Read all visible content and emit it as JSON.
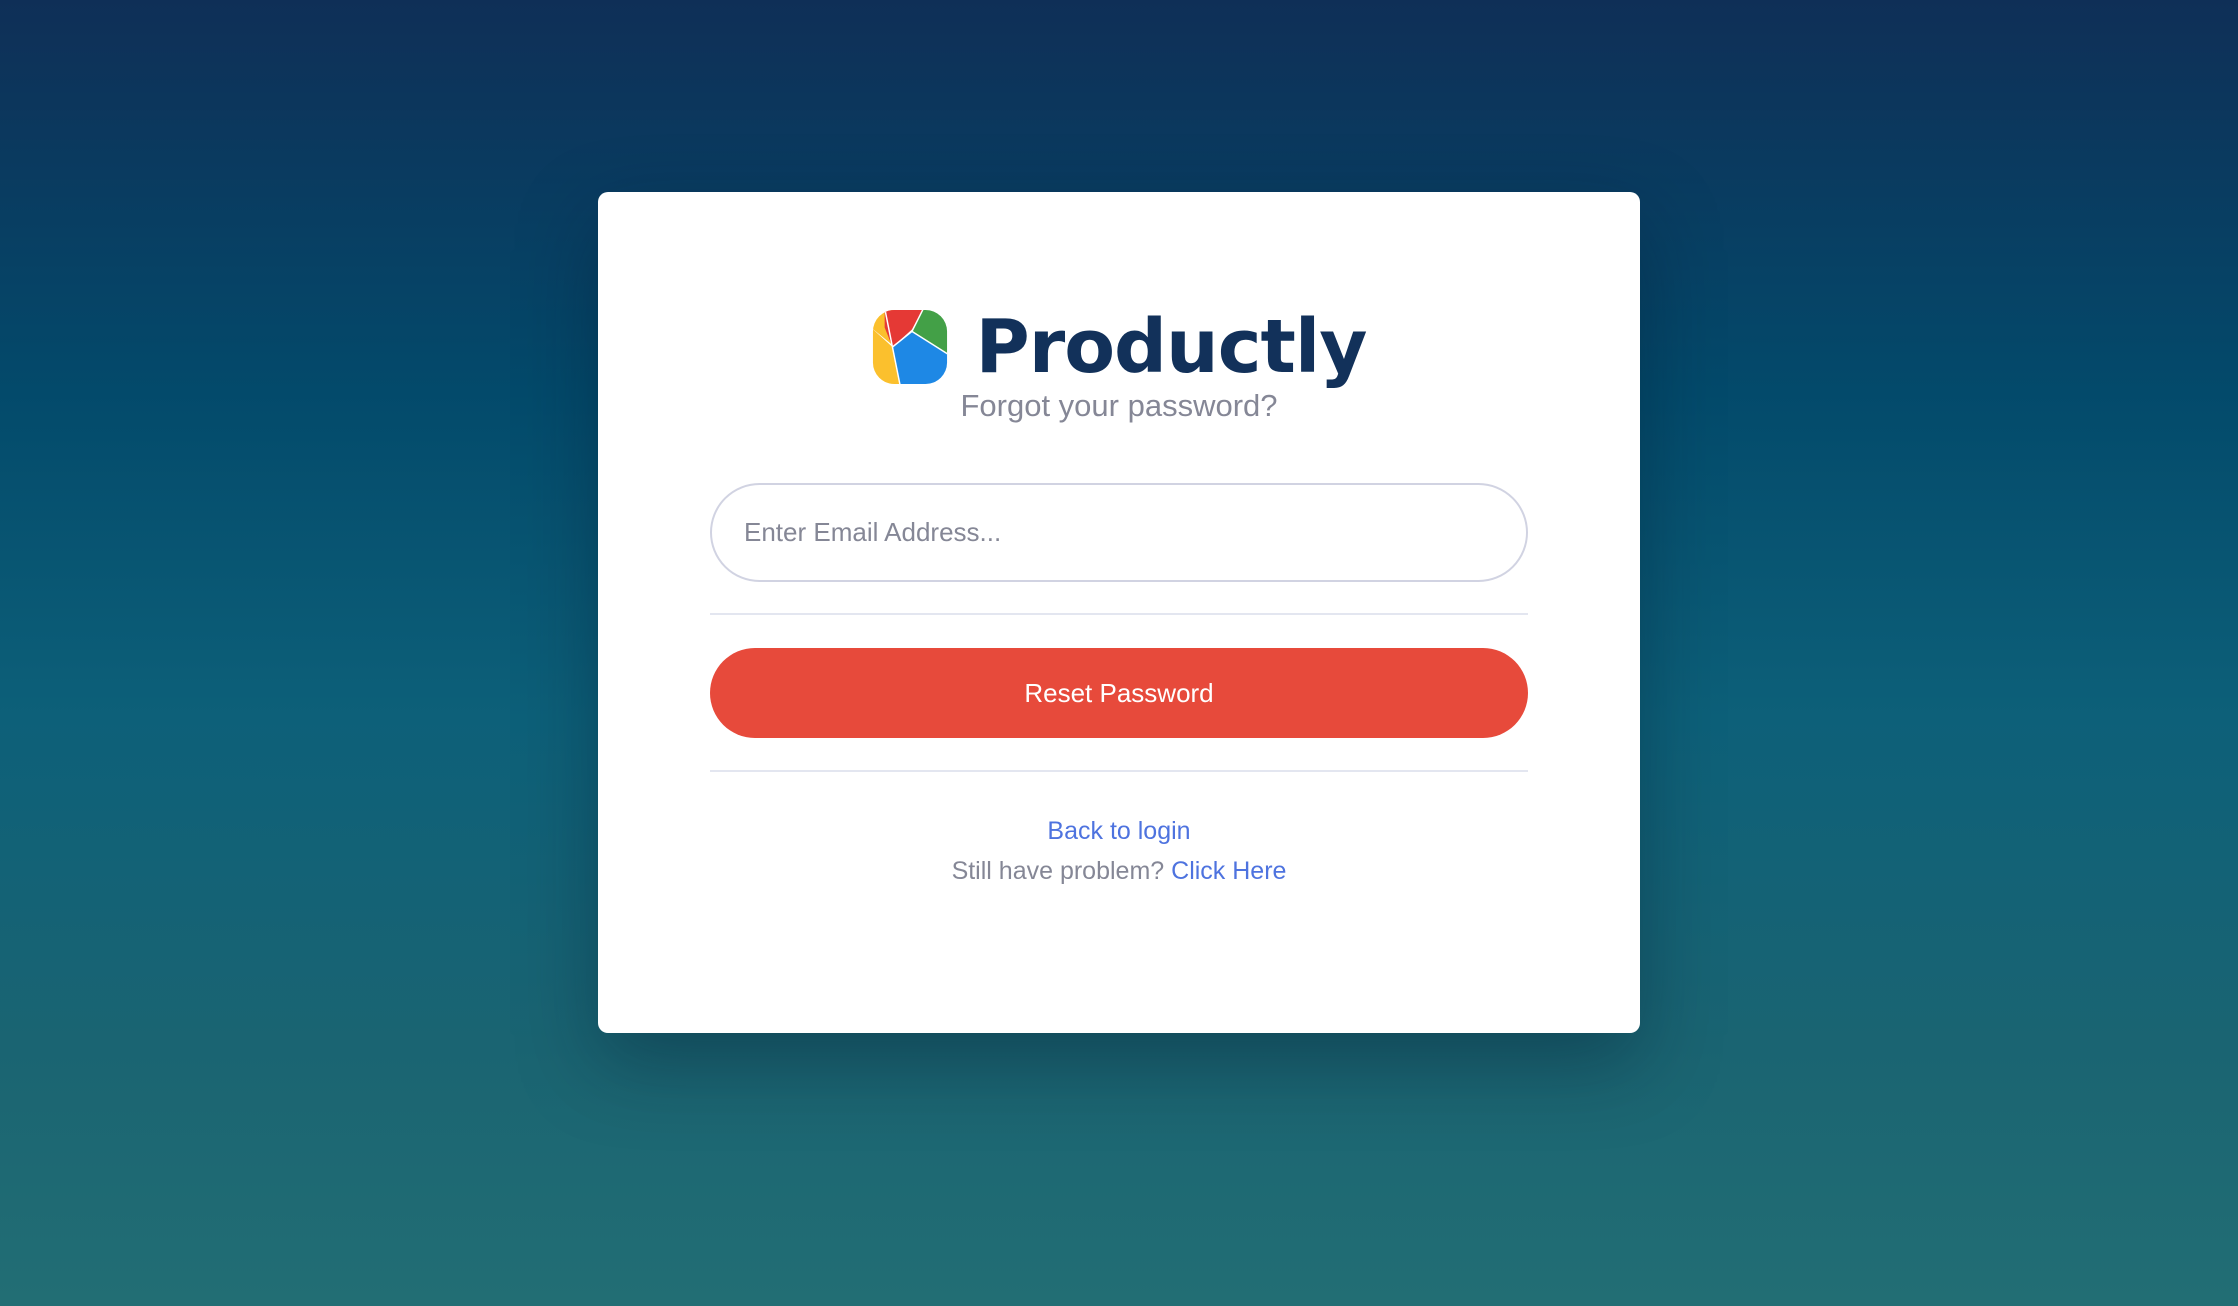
{
  "brand": {
    "name": "Productly",
    "logo_icon": "productly-logo-icon",
    "logo_colors": [
      "#e53935",
      "#43a047",
      "#1e88e5",
      "#fbc02d"
    ]
  },
  "form": {
    "subtitle": "Forgot your password?",
    "email_placeholder": "Enter Email Address...",
    "email_value": "",
    "submit_label": "Reset Password"
  },
  "links": {
    "back_to_login": "Back to login",
    "help_prefix": "Still have problem?",
    "help_link": "Click Here"
  },
  "colors": {
    "accent_button": "#e74a3b",
    "link": "#4e73df",
    "brand_text": "#12315a"
  }
}
